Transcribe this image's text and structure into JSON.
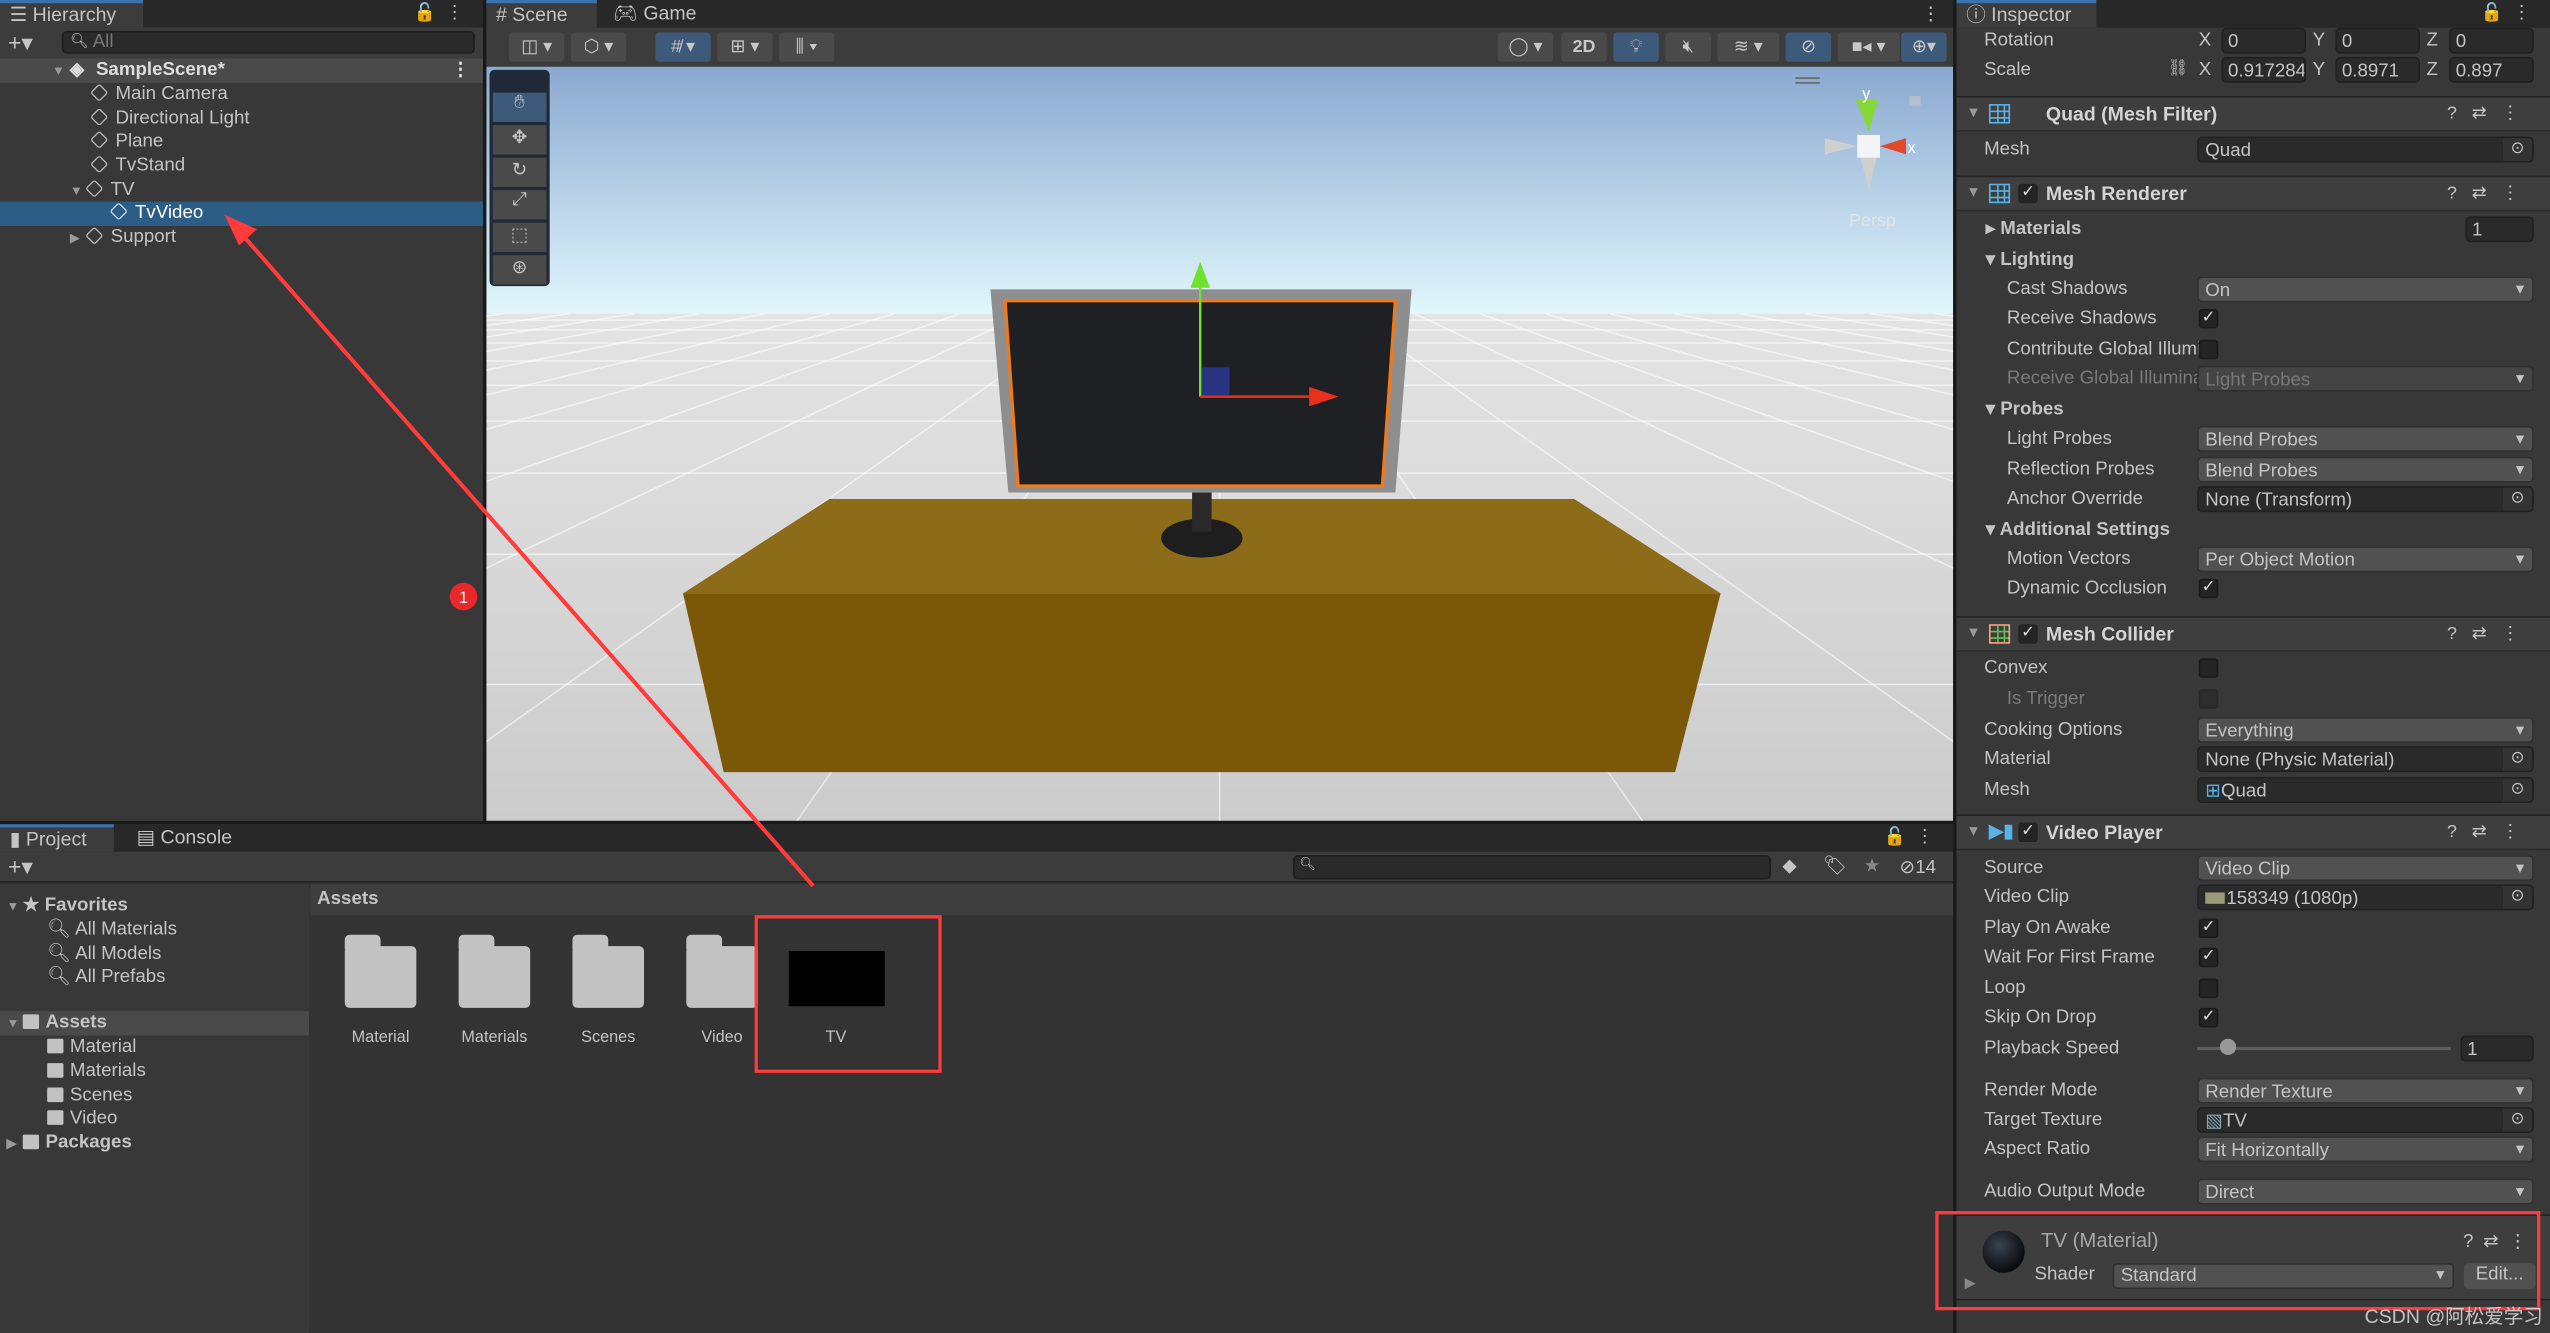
{
  "hierarchy": {
    "tab": "Hierarchy",
    "search_placeholder": "All",
    "scene": "SampleScene*",
    "items": [
      "Main Camera",
      "Directional Light",
      "Plane",
      "TvStand",
      "TV",
      "TvVideo",
      "Support"
    ],
    "selected": "TvVideo"
  },
  "scene_view": {
    "tabs": [
      "Scene",
      "Game"
    ],
    "toggle_2d": "2D",
    "persp_label": "Persp",
    "gizmo_axes": {
      "y": "y",
      "x": "x"
    },
    "colors": {
      "sky_top": "#8aa8d0",
      "ground": "#d6d6d6",
      "stand": "#7a5808",
      "screen_outline": "#f07a1a"
    }
  },
  "project": {
    "tabs": [
      "Project",
      "Console"
    ],
    "hidden_count": "14",
    "favorites": {
      "label": "Favorites",
      "items": [
        "All Materials",
        "All Models",
        "All Prefabs"
      ]
    },
    "assets_tree": {
      "label": "Assets",
      "items": [
        "Material",
        "Materials",
        "Scenes",
        "Video"
      ]
    },
    "packages": "Packages",
    "breadcrumb": "Assets",
    "grid_items": [
      {
        "name": "Material",
        "type": "folder"
      },
      {
        "name": "Materials",
        "type": "folder"
      },
      {
        "name": "Scenes",
        "type": "folder"
      },
      {
        "name": "Video",
        "type": "folder"
      },
      {
        "name": "TV",
        "type": "render-texture"
      }
    ]
  },
  "inspector": {
    "tab": "Inspector",
    "transform": {
      "rotation": {
        "label": "Rotation",
        "x": "0",
        "y": "0",
        "z": "0"
      },
      "scale": {
        "label": "Scale",
        "x": "0.917284",
        "y": "0.8971",
        "z": "0.897"
      }
    },
    "mesh_filter": {
      "title": "Quad (Mesh Filter)",
      "mesh_label": "Mesh",
      "mesh": "Quad"
    },
    "mesh_renderer": {
      "title": "Mesh Renderer",
      "enabled": true,
      "materials_label": "Materials",
      "materials_count": "1",
      "lighting": "Lighting",
      "cast_shadows": {
        "label": "Cast Shadows",
        "value": "On"
      },
      "receive_shadows": {
        "label": "Receive Shadows",
        "checked": true
      },
      "contribute_gi": {
        "label": "Contribute Global Illumination",
        "checked": false
      },
      "receive_gi": {
        "label": "Receive Global Illumination",
        "value": "Light Probes"
      },
      "probes": "Probes",
      "light_probes": {
        "label": "Light Probes",
        "value": "Blend Probes"
      },
      "reflection_probes": {
        "label": "Reflection Probes",
        "value": "Blend Probes"
      },
      "anchor_override": {
        "label": "Anchor Override",
        "value": "None (Transform)"
      },
      "additional": "Additional Settings",
      "motion_vectors": {
        "label": "Motion Vectors",
        "value": "Per Object Motion"
      },
      "dynamic_occlusion": {
        "label": "Dynamic Occlusion",
        "checked": true
      }
    },
    "mesh_collider": {
      "title": "Mesh Collider",
      "enabled": true,
      "convex": {
        "label": "Convex",
        "checked": false
      },
      "is_trigger": {
        "label": "Is Trigger",
        "checked": false
      },
      "cooking": {
        "label": "Cooking Options",
        "value": "Everything"
      },
      "material": {
        "label": "Material",
        "value": "None (Physic Material)"
      },
      "mesh": {
        "label": "Mesh",
        "value": "Quad"
      }
    },
    "video_player": {
      "title": "Video Player",
      "enabled": true,
      "source": {
        "label": "Source",
        "value": "Video Clip"
      },
      "video_clip": {
        "label": "Video Clip",
        "value": "158349 (1080p)"
      },
      "play_on_awake": {
        "label": "Play On Awake",
        "checked": true
      },
      "wait_first_frame": {
        "label": "Wait For First Frame",
        "checked": true
      },
      "loop": {
        "label": "Loop",
        "checked": false
      },
      "skip_on_drop": {
        "label": "Skip On Drop",
        "checked": true
      },
      "playback_speed": {
        "label": "Playback Speed",
        "value": "1",
        "slider_fraction": 0.12
      },
      "render_mode": {
        "label": "Render Mode",
        "value": "Render Texture"
      },
      "target_texture": {
        "label": "Target Texture",
        "value": "TV"
      },
      "aspect_ratio": {
        "label": "Aspect Ratio",
        "value": "Fit Horizontally"
      },
      "audio_output": {
        "label": "Audio Output Mode",
        "value": "Direct"
      }
    },
    "material": {
      "title": "TV (Material)",
      "shader_label": "Shader",
      "shader": "Standard",
      "edit": "Edit..."
    }
  },
  "annotations": {
    "badge": "1",
    "color": "#ff3b3b"
  },
  "watermark": "CSDN @阿松爱学习"
}
